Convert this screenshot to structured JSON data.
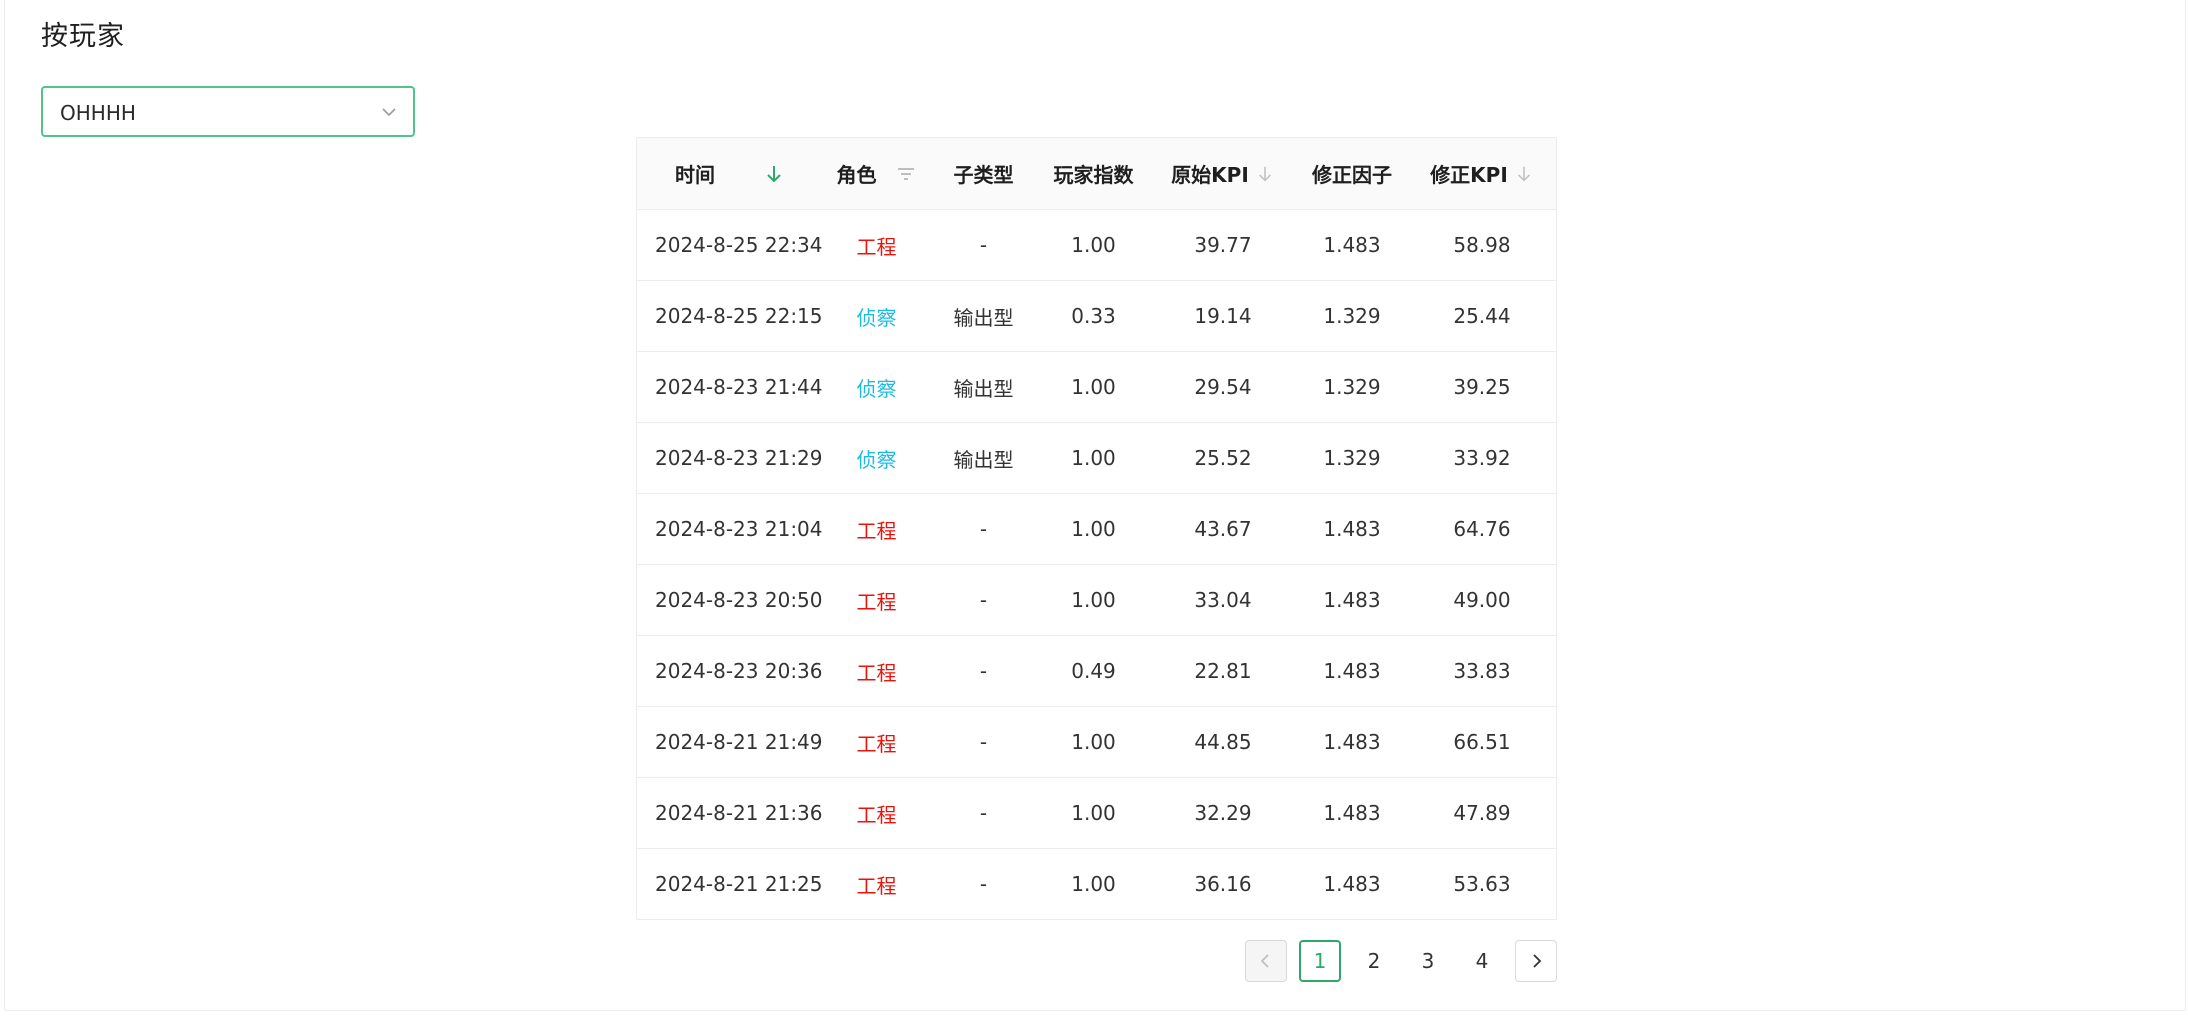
{
  "title": "按玩家",
  "player_select": {
    "value": "OHHHH"
  },
  "table": {
    "columns": [
      "时间",
      "角色",
      "子类型",
      "玩家指数",
      "原始KPI",
      "修正因子",
      "修正KPI"
    ],
    "rows": [
      {
        "time": "2024-8-25 22:34",
        "role": "工程",
        "role_type": "eng",
        "subtype": "-",
        "index": "1.00",
        "raw_kpi": "39.77",
        "factor": "1.483",
        "kpi": "58.98"
      },
      {
        "time": "2024-8-25 22:15",
        "role": "侦察",
        "role_type": "scout",
        "subtype": "输出型",
        "index": "0.33",
        "raw_kpi": "19.14",
        "factor": "1.329",
        "kpi": "25.44"
      },
      {
        "time": "2024-8-23 21:44",
        "role": "侦察",
        "role_type": "scout",
        "subtype": "输出型",
        "index": "1.00",
        "raw_kpi": "29.54",
        "factor": "1.329",
        "kpi": "39.25"
      },
      {
        "time": "2024-8-23 21:29",
        "role": "侦察",
        "role_type": "scout",
        "subtype": "输出型",
        "index": "1.00",
        "raw_kpi": "25.52",
        "factor": "1.329",
        "kpi": "33.92"
      },
      {
        "time": "2024-8-23 21:04",
        "role": "工程",
        "role_type": "eng",
        "subtype": "-",
        "index": "1.00",
        "raw_kpi": "43.67",
        "factor": "1.483",
        "kpi": "64.76"
      },
      {
        "time": "2024-8-23 20:50",
        "role": "工程",
        "role_type": "eng",
        "subtype": "-",
        "index": "1.00",
        "raw_kpi": "33.04",
        "factor": "1.483",
        "kpi": "49.00"
      },
      {
        "time": "2024-8-23 20:36",
        "role": "工程",
        "role_type": "eng",
        "subtype": "-",
        "index": "0.49",
        "raw_kpi": "22.81",
        "factor": "1.483",
        "kpi": "33.83"
      },
      {
        "time": "2024-8-21 21:49",
        "role": "工程",
        "role_type": "eng",
        "subtype": "-",
        "index": "1.00",
        "raw_kpi": "44.85",
        "factor": "1.483",
        "kpi": "66.51"
      },
      {
        "time": "2024-8-21 21:36",
        "role": "工程",
        "role_type": "eng",
        "subtype": "-",
        "index": "1.00",
        "raw_kpi": "32.29",
        "factor": "1.483",
        "kpi": "47.89"
      },
      {
        "time": "2024-8-21 21:25",
        "role": "工程",
        "role_type": "eng",
        "subtype": "-",
        "index": "1.00",
        "raw_kpi": "36.16",
        "factor": "1.483",
        "kpi": "53.63"
      }
    ]
  },
  "pagination": {
    "pages": [
      "1",
      "2",
      "3",
      "4"
    ],
    "current": "1"
  },
  "colors": {
    "accent": "#2fa86b",
    "select_border": "#52c48a",
    "role_engineer": "#e8140b",
    "role_scout": "#1ebbe0",
    "header_bg": "#fafafa"
  },
  "icons": {
    "time_sort": "arrow-down-icon (active)",
    "role_filter": "filter-icon",
    "raw_kpi_sort": "arrow-down-icon",
    "kpi_sort": "arrow-down-icon",
    "select": "chevron-down-icon",
    "prev": "chevron-left-icon",
    "next": "chevron-right-icon"
  }
}
